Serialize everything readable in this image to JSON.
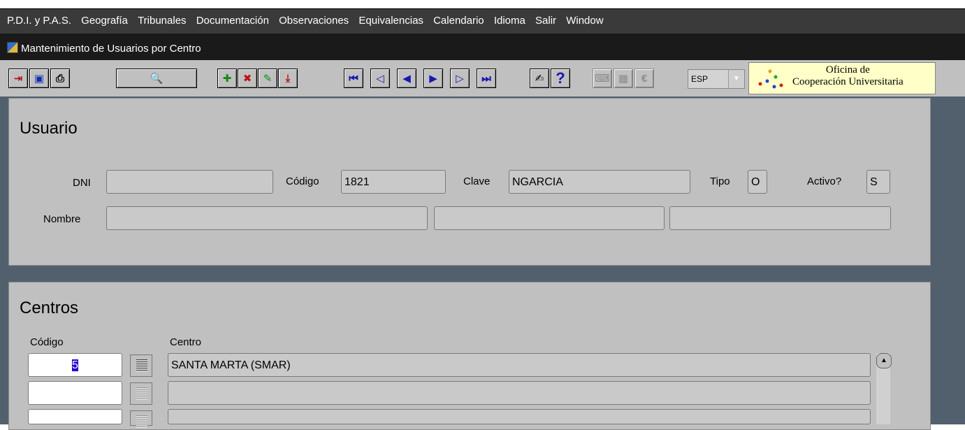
{
  "menu": [
    {
      "label": "P.D.I. y P.A.S."
    },
    {
      "label": "Geografía"
    },
    {
      "label": "Tribunales"
    },
    {
      "label": "Documentación"
    },
    {
      "label": "Observaciones"
    },
    {
      "label": "Equivalencias"
    },
    {
      "label": "Calendario"
    },
    {
      "label": "Idioma"
    },
    {
      "label": "Salir"
    },
    {
      "label": "Window"
    }
  ],
  "window": {
    "title": "Mantenimiento de Usuarios por Centro"
  },
  "toolbar": {
    "language": "ESP",
    "logo_line1": "Oficina de",
    "logo_line2": "Cooperación Universitaria",
    "help_glyph": "?"
  },
  "usuario": {
    "title": "Usuario",
    "dni_label": "DNI",
    "dni_value": "",
    "codigo_label": "Código",
    "codigo_value": "1821",
    "clave_label": "Clave",
    "clave_value": "NGARCIA",
    "tipo_label": "Tipo",
    "tipo_value": "O",
    "activo_label": "Activo?",
    "activo_value": "S",
    "nombre_label": "Nombre",
    "nombre_1": "",
    "nombre_2": "",
    "nombre_3": ""
  },
  "centros": {
    "title": "Centros",
    "col_codigo": "Código",
    "col_centro": "Centro",
    "rows": [
      {
        "codigo": "5",
        "centro": "SANTA MARTA (SMAR)"
      },
      {
        "codigo": "",
        "centro": ""
      },
      {
        "codigo": "",
        "centro": ""
      }
    ]
  }
}
